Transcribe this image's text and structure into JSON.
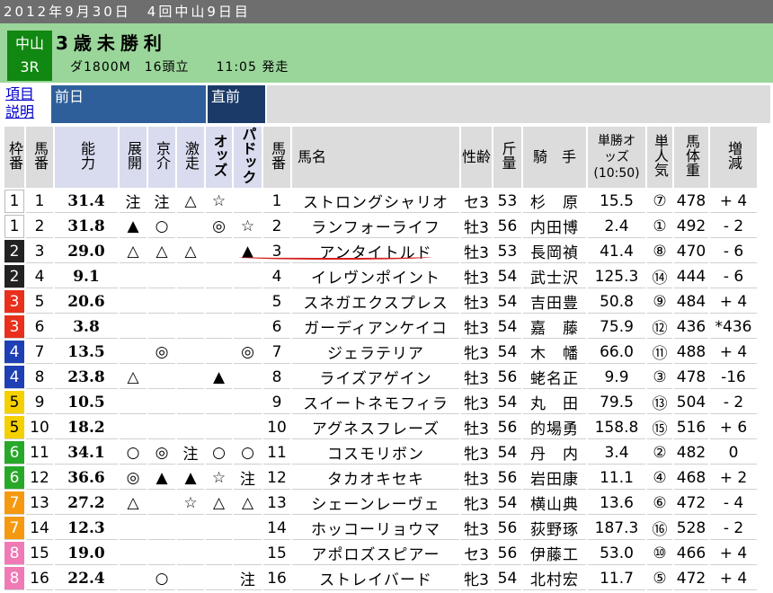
{
  "header": {
    "date_line": "2012年9月30日　4回中山9日目",
    "venue": "中山",
    "race_no": "3R",
    "race_name": "3歳未勝利",
    "race_info": "ダ1800M　16頭立　　11:05 発走"
  },
  "bands": {
    "legend_line1": "項目",
    "legend_line2": "説明",
    "prev": "前日",
    "now": "直前"
  },
  "columns": {
    "waku": "枠番",
    "umaban": "馬番",
    "ability": "能力",
    "tenkai": "展開",
    "kyoukai": "京介",
    "gekisou": "激走",
    "odds_mark": "オッズ",
    "paddock": "パドック",
    "umaban2": "馬番",
    "name": "馬名",
    "sex_age": "性齢",
    "kinryo": "斤量",
    "jockey": "騎　手",
    "win_odds": "単勝オッズ(10:50)",
    "popularity": "単人気",
    "weight": "馬体重",
    "diff": "増減"
  },
  "colors": {
    "waku1": "#ffffff",
    "waku2": "#222222",
    "waku3": "#e8301c",
    "waku4": "#1f3fb5",
    "waku5": "#f5d000",
    "waku6": "#28a828",
    "waku7": "#f59a10",
    "waku8": "#f07ab5"
  },
  "rows": [
    {
      "waku": "1",
      "umaban": "1",
      "ability": "31.4",
      "tenkai": "注",
      "kyoukai": "注",
      "gekisou": "△",
      "odds_mark": "☆",
      "paddock": "",
      "umaban2": "1",
      "name": "ストロングシャリオ",
      "sex_age": "セ3",
      "kinryo": "53",
      "jockey": "杉　原",
      "win_odds": "15.5",
      "popularity": "⑦",
      "weight": "478",
      "diff": "+ 4"
    },
    {
      "waku": "1",
      "umaban": "2",
      "ability": "31.8",
      "tenkai": "▲",
      "kyoukai": "○",
      "gekisou": "",
      "odds_mark": "◎",
      "paddock": "☆",
      "umaban2": "2",
      "name": "ランフォーライフ",
      "sex_age": "牡3",
      "kinryo": "56",
      "jockey": "内田博",
      "win_odds": "2.4",
      "popularity": "①",
      "weight": "492",
      "diff": "- 2"
    },
    {
      "waku": "2",
      "umaban": "3",
      "ability": "29.0",
      "tenkai": "△",
      "kyoukai": "△",
      "gekisou": "△",
      "odds_mark": "",
      "paddock": "▲",
      "umaban2": "3",
      "name": "アンタイトルド",
      "sex_age": "牡3",
      "kinryo": "53",
      "jockey": "長岡禎",
      "win_odds": "41.4",
      "popularity": "⑧",
      "weight": "470",
      "diff": "- 6"
    },
    {
      "waku": "2",
      "umaban": "4",
      "ability": "9.1",
      "tenkai": "",
      "kyoukai": "",
      "gekisou": "",
      "odds_mark": "",
      "paddock": "",
      "umaban2": "4",
      "name": "イレヴンポイント",
      "sex_age": "牡3",
      "kinryo": "54",
      "jockey": "武士沢",
      "win_odds": "125.3",
      "popularity": "⑭",
      "weight": "444",
      "diff": "- 6"
    },
    {
      "waku": "3",
      "umaban": "5",
      "ability": "20.6",
      "tenkai": "",
      "kyoukai": "",
      "gekisou": "",
      "odds_mark": "",
      "paddock": "",
      "umaban2": "5",
      "name": "スネガエクスプレス",
      "sex_age": "牡3",
      "kinryo": "54",
      "jockey": "吉田豊",
      "win_odds": "50.8",
      "popularity": "⑨",
      "weight": "484",
      "diff": "+ 4"
    },
    {
      "waku": "3",
      "umaban": "6",
      "ability": "3.8",
      "tenkai": "",
      "kyoukai": "",
      "gekisou": "",
      "odds_mark": "",
      "paddock": "",
      "umaban2": "6",
      "name": "ガーディアンケイコ",
      "sex_age": "牡3",
      "kinryo": "54",
      "jockey": "嘉　藤",
      "win_odds": "75.9",
      "popularity": "⑫",
      "weight": "436",
      "diff": "*436"
    },
    {
      "waku": "4",
      "umaban": "7",
      "ability": "13.5",
      "tenkai": "",
      "kyoukai": "◎",
      "gekisou": "",
      "odds_mark": "",
      "paddock": "◎",
      "umaban2": "7",
      "name": "ジェラテリア",
      "sex_age": "牝3",
      "kinryo": "54",
      "jockey": "木　幡",
      "win_odds": "66.0",
      "popularity": "⑪",
      "weight": "488",
      "diff": "+ 4"
    },
    {
      "waku": "4",
      "umaban": "8",
      "ability": "23.8",
      "tenkai": "△",
      "kyoukai": "",
      "gekisou": "",
      "odds_mark": "▲",
      "paddock": "",
      "umaban2": "8",
      "name": "ライズアゲイン",
      "sex_age": "牡3",
      "kinryo": "56",
      "jockey": "蛯名正",
      "win_odds": "9.9",
      "popularity": "③",
      "weight": "478",
      "diff": "-16"
    },
    {
      "waku": "5",
      "umaban": "9",
      "ability": "10.5",
      "tenkai": "",
      "kyoukai": "",
      "gekisou": "",
      "odds_mark": "",
      "paddock": "",
      "umaban2": "9",
      "name": "スイートネモフィラ",
      "sex_age": "牝3",
      "kinryo": "54",
      "jockey": "丸　田",
      "win_odds": "79.5",
      "popularity": "⑬",
      "weight": "504",
      "diff": "- 2"
    },
    {
      "waku": "5",
      "umaban": "10",
      "ability": "18.2",
      "tenkai": "",
      "kyoukai": "",
      "gekisou": "",
      "odds_mark": "",
      "paddock": "",
      "umaban2": "10",
      "name": "アグネスフレーズ",
      "sex_age": "牡3",
      "kinryo": "56",
      "jockey": "的場勇",
      "win_odds": "158.8",
      "popularity": "⑮",
      "weight": "516",
      "diff": "+ 6"
    },
    {
      "waku": "6",
      "umaban": "11",
      "ability": "34.1",
      "tenkai": "○",
      "kyoukai": "◎",
      "gekisou": "注",
      "odds_mark": "○",
      "paddock": "○",
      "umaban2": "11",
      "name": "コスモリボン",
      "sex_age": "牝3",
      "kinryo": "54",
      "jockey": "丹　内",
      "win_odds": "3.4",
      "popularity": "②",
      "weight": "482",
      "diff": "0"
    },
    {
      "waku": "6",
      "umaban": "12",
      "ability": "36.6",
      "tenkai": "◎",
      "kyoukai": "▲",
      "gekisou": "▲",
      "odds_mark": "☆",
      "paddock": "注",
      "umaban2": "12",
      "name": "タカオキセキ",
      "sex_age": "牡3",
      "kinryo": "56",
      "jockey": "岩田康",
      "win_odds": "11.1",
      "popularity": "④",
      "weight": "468",
      "diff": "+ 2"
    },
    {
      "waku": "7",
      "umaban": "13",
      "ability": "27.2",
      "tenkai": "△",
      "kyoukai": "",
      "gekisou": "☆",
      "odds_mark": "△",
      "paddock": "△",
      "umaban2": "13",
      "name": "シェーンレーヴェ",
      "sex_age": "牝3",
      "kinryo": "54",
      "jockey": "横山典",
      "win_odds": "13.6",
      "popularity": "⑥",
      "weight": "472",
      "diff": "- 4"
    },
    {
      "waku": "7",
      "umaban": "14",
      "ability": "12.3",
      "tenkai": "",
      "kyoukai": "",
      "gekisou": "",
      "odds_mark": "",
      "paddock": "",
      "umaban2": "14",
      "name": "ホッコーリョウマ",
      "sex_age": "牡3",
      "kinryo": "56",
      "jockey": "荻野琢",
      "win_odds": "187.3",
      "popularity": "⑯",
      "weight": "528",
      "diff": "- 2"
    },
    {
      "waku": "8",
      "umaban": "15",
      "ability": "19.0",
      "tenkai": "",
      "kyoukai": "",
      "gekisou": "",
      "odds_mark": "",
      "paddock": "",
      "umaban2": "15",
      "name": "アポロズスピアー",
      "sex_age": "セ3",
      "kinryo": "56",
      "jockey": "伊藤工",
      "win_odds": "53.0",
      "popularity": "⑩",
      "weight": "466",
      "diff": "+ 4"
    },
    {
      "waku": "8",
      "umaban": "16",
      "ability": "22.4",
      "tenkai": "",
      "kyoukai": "○",
      "gekisou": "",
      "odds_mark": "",
      "paddock": "注",
      "umaban2": "16",
      "name": "ストレイバード",
      "sex_age": "牝3",
      "kinryo": "54",
      "jockey": "北村宏",
      "win_odds": "11.7",
      "popularity": "⑤",
      "weight": "472",
      "diff": "+ 4"
    }
  ]
}
